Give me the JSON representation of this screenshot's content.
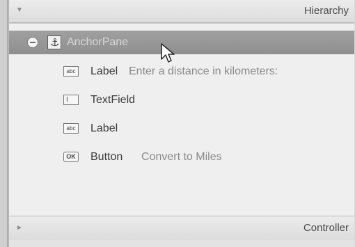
{
  "hierarchy_panel": {
    "title": "Hierarchy",
    "nodes": [
      {
        "type": "AnchorPane",
        "text": "",
        "icon": "anchor-icon",
        "selected": true,
        "expanded": true
      },
      {
        "type": "Label",
        "text": "Enter a distance in kilometers:",
        "icon": "abc-icon"
      },
      {
        "type": "TextField",
        "text": "",
        "icon": "textfield-icon"
      },
      {
        "type": "Label",
        "text": "",
        "icon": "abc-icon"
      },
      {
        "type": "Button",
        "text": "Convert to Miles",
        "icon": "ok-icon"
      }
    ]
  },
  "controller_panel": {
    "title": "Controller"
  },
  "icons": {
    "label_icon_text": "abc",
    "textfield_icon_text": "I",
    "button_icon_text": "OK",
    "anchor_glyph": "⚓"
  },
  "colors": {
    "selected_row": "#969696",
    "panel_bg": "#efefef",
    "header_bg": "#e2e2e2",
    "type_text": "#3a3a3a",
    "secondary_text": "#8a8a8a"
  }
}
